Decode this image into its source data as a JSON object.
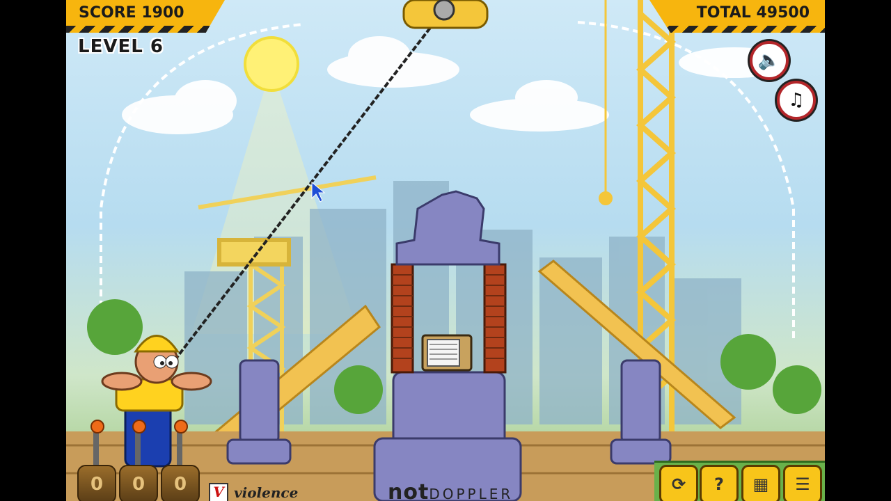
{
  "hud": {
    "score_label": "SCORE 1900",
    "total_label": "TOTAL 49500",
    "level_label": "LEVEL 6"
  },
  "controls": {
    "sound_icon": "speaker-icon",
    "music_icon": "music-note-icon",
    "buttons": [
      {
        "name": "restart-button",
        "icon": "restart-icon",
        "symbol": "⟳"
      },
      {
        "name": "help-button",
        "icon": "help-icon",
        "symbol": "?"
      },
      {
        "name": "level-select-button",
        "icon": "grid-icon",
        "symbol": "▦"
      },
      {
        "name": "menu-button",
        "icon": "list-icon",
        "symbol": "☰"
      }
    ]
  },
  "counters": [
    "0",
    "0",
    "0"
  ],
  "footer": {
    "violence_label": "violence",
    "violence_check": "V",
    "brand_not": "not",
    "brand_doppler": "DOPPLER"
  },
  "colors": {
    "hud_yellow": "#f7b50e",
    "stone": "#8686c2",
    "brick": "#b3421d",
    "sky": "#cfe9f7"
  }
}
